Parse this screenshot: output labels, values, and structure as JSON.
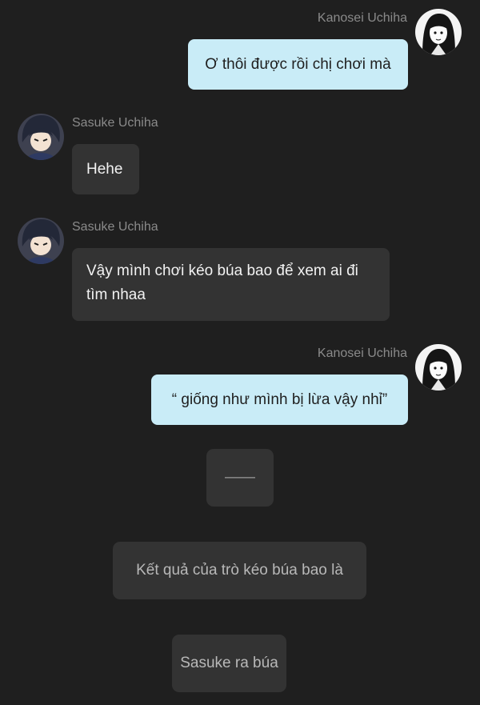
{
  "messages": [
    {
      "sender": "Kanosei Uchiha",
      "text": "Ơ thôi được rồi chị chơi mà",
      "side": "right"
    },
    {
      "sender": "Sasuke Uchiha",
      "text": "Hehe",
      "side": "left"
    },
    {
      "sender": "Sasuke Uchiha",
      "text": "Vậy mình chơi kéo búa bao để xem ai đi tìm nhaa",
      "side": "left"
    },
    {
      "sender": "Kanosei Uchiha",
      "text": "“ giống như mình bị lừa vậy nhỉ”",
      "side": "right"
    }
  ],
  "system": {
    "divider": "——",
    "result_label": "Kết quả của trò kéo búa bao là",
    "result_value": "Sasuke ra búa"
  },
  "icons": {
    "self_avatar": "kanosei-avatar-icon",
    "other_avatar": "sasuke-avatar-icon"
  },
  "colors": {
    "background": "#1f1f1f",
    "self_bubble": "#c9ecf7",
    "other_bubble": "#333333",
    "sender_name": "#8a8a8a"
  }
}
